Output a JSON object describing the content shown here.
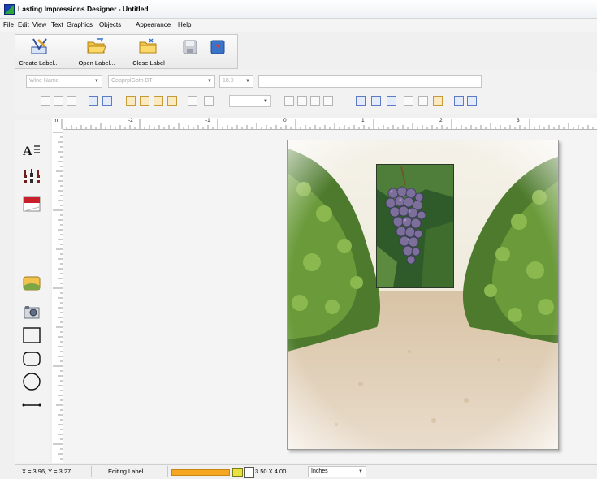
{
  "window": {
    "title": "Lasting Impressions Designer - Untitled"
  },
  "menu": [
    "File",
    "Edit",
    "View",
    "Text",
    "Graphics",
    "Objects",
    "Appearance",
    "Help"
  ],
  "toolbar": {
    "create_label": "Create Label...",
    "open_label": "Open Label...",
    "close_label": "Close Label"
  },
  "format": {
    "font_name_placeholder": "Wine Name",
    "font_face_placeholder": "CopprplGoth BT",
    "font_size_placeholder": "18.0"
  },
  "ruler": {
    "unit_marker": "in",
    "h_ticks": [
      "-2",
      "-1",
      "0",
      "1",
      "2",
      "3"
    ]
  },
  "tools": [
    "text-tool",
    "bottles-tool",
    "calendar-tool",
    "image-tool",
    "camera-tool",
    "rectangle-tool",
    "rounded-rectangle-tool",
    "ellipse-tool",
    "line-tool"
  ],
  "status": {
    "coords": "X = 3.96, Y = 3.27",
    "mode": "Editing Label",
    "size": "3.50 X 4.00",
    "units": "Inches"
  },
  "colors": {
    "progress": "#f5a623",
    "title_bg": "#ffffff"
  }
}
